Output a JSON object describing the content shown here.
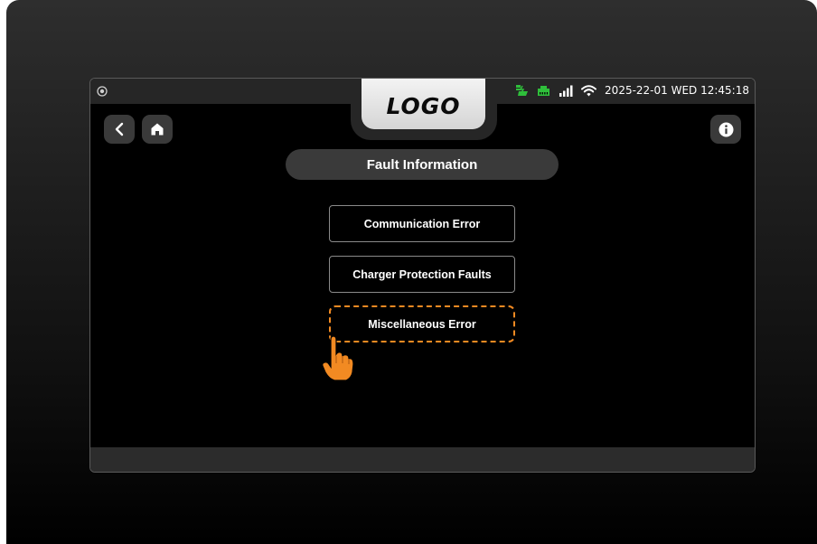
{
  "header": {
    "logo_text": "LOGO",
    "datetime": "2025-22-01 WED 12:45:18"
  },
  "page": {
    "title": "Fault Information"
  },
  "menu": {
    "items": [
      {
        "label": "Communication Error"
      },
      {
        "label": "Charger Protection Faults"
      },
      {
        "label": "Miscellaneous Error"
      }
    ]
  },
  "icons": {
    "camera": "camera-icon",
    "charging": "ev-charging-icon",
    "network": "network-icon",
    "signal": "signal-icon",
    "wifi": "wifi-icon",
    "back": "back-icon",
    "home": "home-icon",
    "info": "info-icon",
    "pointer": "hand-pointer-icon"
  },
  "colors": {
    "accent_highlight": "#f28a22",
    "status_green": "#2fbf3b"
  }
}
